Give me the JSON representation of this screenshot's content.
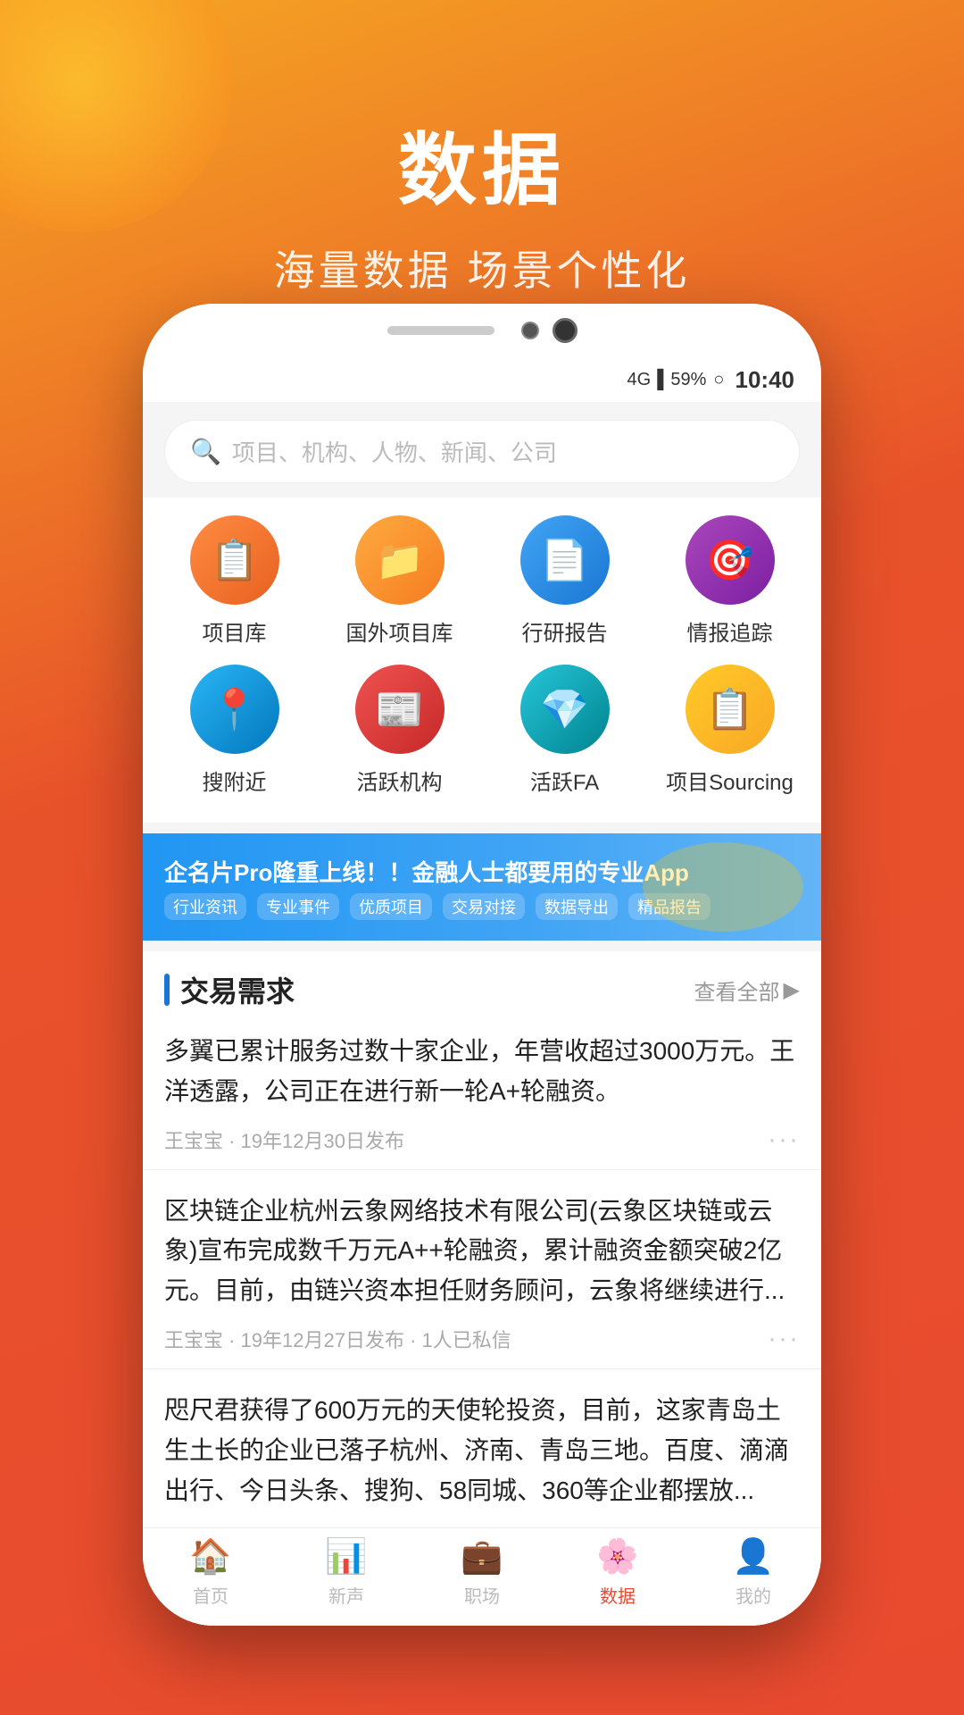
{
  "page": {
    "title": "数据",
    "subtitle": "海量数据  场景个性化",
    "bg_gradient_start": "#f5a623",
    "bg_gradient_end": "#e84a2f"
  },
  "status_bar": {
    "signal": "4G",
    "battery": "59%",
    "time": "10:40"
  },
  "search": {
    "placeholder": "项目、机构、人物、新闻、公司"
  },
  "icon_grid": {
    "rows": [
      [
        {
          "id": "project",
          "label": "项目库",
          "color": "ic-orange",
          "icon": "📋"
        },
        {
          "id": "foreign_project",
          "label": "国外项目库",
          "color": "ic-orange2",
          "icon": "📁"
        },
        {
          "id": "report",
          "label": "行研报告",
          "color": "ic-blue",
          "icon": "📄"
        },
        {
          "id": "intel",
          "label": "情报追踪",
          "color": "ic-purple",
          "icon": "🎯"
        }
      ],
      [
        {
          "id": "nearby",
          "label": "搜附近",
          "color": "ic-blue2",
          "icon": "📍"
        },
        {
          "id": "active_org",
          "label": "活跃机构",
          "color": "ic-red",
          "icon": "📰"
        },
        {
          "id": "active_fa",
          "label": "活跃FA",
          "color": "ic-cyan",
          "icon": "💎"
        },
        {
          "id": "sourcing",
          "label": "项目Sourcing",
          "color": "ic-amber",
          "icon": "📋"
        }
      ]
    ]
  },
  "banner": {
    "main_text": "企名片Pro隆重上线！！金融人士都要用的专业App",
    "tags": [
      "行业资讯",
      "专业事件",
      "优质项目",
      "交易对接",
      "数据导出",
      "精品报告"
    ]
  },
  "section": {
    "title": "交易需求",
    "more_label": "查看全部",
    "news": [
      {
        "text": "多翼已累计服务过数十家企业，年营收超过3000万元。王洋透露，公司正在进行新一轮A+轮融资。",
        "meta": "王宝宝 · 19年12月30日发布",
        "extra": ""
      },
      {
        "text": "区块链企业杭州云象网络技术有限公司(云象区块链或云象)宣布完成数千万元A++轮融资，累计融资金额突破2亿元。目前，由链兴资本担任财务顾问，云象将继续进行...",
        "meta": "王宝宝 · 19年12月27日发布 · 1人已私信",
        "extra": ""
      },
      {
        "text": "咫尺君获得了600万元的天使轮投资，目前，这家青岛土生土长的企业已落子杭州、济南、青岛三地。百度、滴滴出行、今日头条、搜狗、58同城、360等企业都摆放...",
        "meta": "",
        "extra": ""
      }
    ]
  },
  "bottom_nav": {
    "items": [
      {
        "id": "home",
        "label": "首页",
        "icon": "🏠",
        "active": false
      },
      {
        "id": "xinsheng",
        "label": "新声",
        "icon": "📊",
        "active": false
      },
      {
        "id": "zhichang",
        "label": "职场",
        "icon": "💼",
        "active": false
      },
      {
        "id": "data",
        "label": "数据",
        "icon": "🌸",
        "active": true
      },
      {
        "id": "mine",
        "label": "我的",
        "icon": "👤",
        "active": false
      }
    ]
  }
}
